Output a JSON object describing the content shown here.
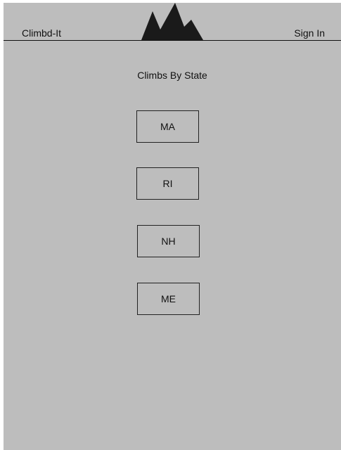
{
  "header": {
    "brand": "Climbd-It",
    "sign_in": "Sign In",
    "logo_icon": "mountain-logo-icon"
  },
  "main": {
    "title": "Climbs By State",
    "states": [
      {
        "label": "MA"
      },
      {
        "label": "RI"
      },
      {
        "label": "NH"
      },
      {
        "label": "ME"
      }
    ]
  },
  "colors": {
    "background": "#bdbdbd",
    "ink": "#111111"
  }
}
